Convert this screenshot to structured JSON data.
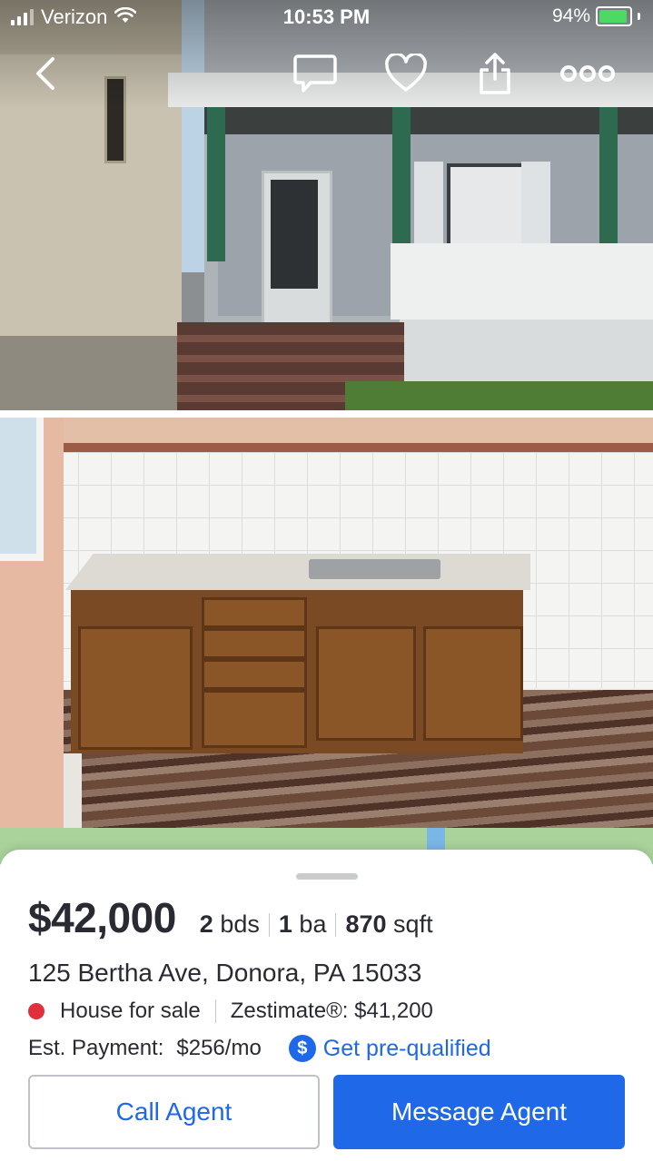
{
  "status_bar": {
    "carrier": "Verizon",
    "time": "10:53 PM",
    "battery": "94%"
  },
  "nav": {
    "icons": [
      "back-icon",
      "message-icon",
      "heart-icon",
      "share-icon",
      "more-icon"
    ]
  },
  "photos": {
    "images": [
      "house-exterior-photo",
      "kitchen-photo"
    ]
  },
  "listing": {
    "price": "$42,000",
    "beds_num": "2",
    "beds_unit": "bds",
    "baths_num": "1",
    "baths_unit": "ba",
    "sqft_num": "870",
    "sqft_unit": "sqft",
    "address": "125 Bertha Ave, Donora, PA 15033",
    "status": "House for sale",
    "zestimate": "Zestimate®: $41,200",
    "est_payment_label": "Est. Payment:",
    "est_payment_value": "$256/mo",
    "prequal_icon": "$",
    "prequal_label": "Get pre-qualified"
  },
  "actions": {
    "call_agent": "Call Agent",
    "message_agent": "Message Agent"
  },
  "colors": {
    "accent": "#1f68e8",
    "status_dot": "#e0303b",
    "text": "#2a2a33"
  }
}
